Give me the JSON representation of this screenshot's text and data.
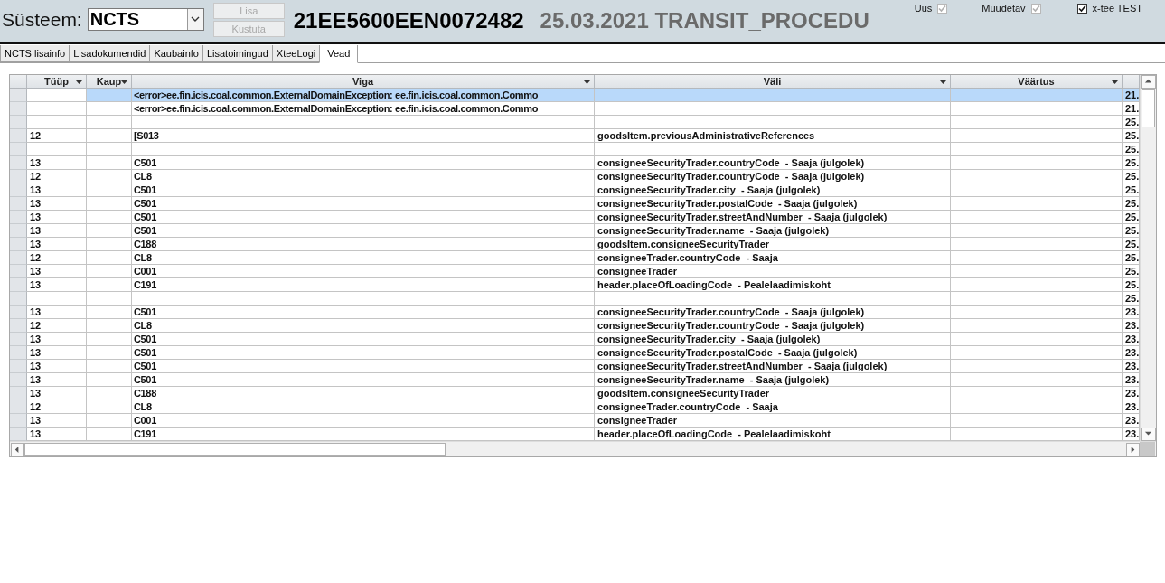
{
  "header": {
    "system_label": "Süsteem:",
    "system_value": "NCTS",
    "buttons": [
      {
        "label": "Lisa",
        "disabled": true
      },
      {
        "label": "Kustuta",
        "disabled": true
      }
    ],
    "document_number": "21EE5600EEN0072482",
    "document_subtitle": "25.03.2021 TRANSIT_PROCEDU",
    "checkboxes": [
      {
        "label": "Uus",
        "checked": true,
        "disabled": true
      },
      {
        "label": "Muudetav",
        "checked": true,
        "disabled": true
      },
      {
        "label": "x-tee TEST",
        "checked": true,
        "disabled": false
      }
    ]
  },
  "tabs": [
    {
      "label": "NCTS lisainfo",
      "selected": false
    },
    {
      "label": "Lisadokumendid",
      "selected": false
    },
    {
      "label": "Kaubainfo",
      "selected": false
    },
    {
      "label": "Lisatoimingud",
      "selected": false
    },
    {
      "label": "XteeLogi",
      "selected": false
    },
    {
      "label": "Vead",
      "selected": true
    }
  ],
  "table": {
    "columns": [
      "Tüüp",
      "Kaup",
      "Viga",
      "Väli",
      "Väärtus"
    ],
    "rows": [
      {
        "selected": true,
        "viga": "<error>ee.fin.icis.coal.common.ExternalDomainException: ee.fin.icis.coal.common.Commo",
        "column_6": "21."
      },
      {
        "selected": false,
        "viga": "<error>ee.fin.icis.coal.common.ExternalDomainException: ee.fin.icis.coal.common.Commo",
        "column_6": "21."
      },
      {
        "selected": false,
        "column_6": "25."
      },
      {
        "selected": false,
        "tyyp": "12",
        "viga": "[S013",
        "vali": "goodsItem.previousAdministrativeReferences",
        "column_6": "25."
      },
      {
        "selected": false,
        "column_6": "25."
      },
      {
        "selected": false,
        "tyyp": "13",
        "viga": "C501",
        "vali": "consigneeSecurityTrader.countryCode  - Saaja (julgolek)",
        "column_6": "25."
      },
      {
        "selected": false,
        "tyyp": "12",
        "viga": "CL8",
        "vali": "consigneeSecurityTrader.countryCode  - Saaja (julgolek)",
        "column_6": "25."
      },
      {
        "selected": false,
        "tyyp": "13",
        "viga": "C501",
        "vali": "consigneeSecurityTrader.city  - Saaja (julgolek)",
        "column_6": "25."
      },
      {
        "selected": false,
        "tyyp": "13",
        "viga": "C501",
        "vali": "consigneeSecurityTrader.postalCode  - Saaja (julgolek)",
        "column_6": "25."
      },
      {
        "selected": false,
        "tyyp": "13",
        "viga": "C501",
        "vali": "consigneeSecurityTrader.streetAndNumber  - Saaja (julgolek)",
        "column_6": "25."
      },
      {
        "selected": false,
        "tyyp": "13",
        "viga": "C501",
        "vali": "consigneeSecurityTrader.name  - Saaja (julgolek)",
        "column_6": "25."
      },
      {
        "selected": false,
        "tyyp": "13",
        "viga": "C188",
        "vali": "goodsItem.consigneeSecurityTrader",
        "column_6": "25."
      },
      {
        "selected": false,
        "tyyp": "12",
        "viga": "CL8",
        "vali": "consigneeTrader.countryCode  - Saaja",
        "column_6": "25."
      },
      {
        "selected": false,
        "tyyp": "13",
        "viga": "C001",
        "vali": "consigneeTrader",
        "column_6": "25."
      },
      {
        "selected": false,
        "tyyp": "13",
        "viga": "C191",
        "vali": "header.placeOfLoadingCode  - Pealelaadimiskoht",
        "column_6": "25."
      },
      {
        "selected": false,
        "column_6": "25."
      },
      {
        "selected": false,
        "tyyp": "13",
        "viga": "C501",
        "vali": "consigneeSecurityTrader.countryCode  - Saaja (julgolek)",
        "column_6": "23."
      },
      {
        "selected": false,
        "tyyp": "12",
        "viga": "CL8",
        "vali": "consigneeSecurityTrader.countryCode  - Saaja (julgolek)",
        "column_6": "23."
      },
      {
        "selected": false,
        "tyyp": "13",
        "viga": "C501",
        "vali": "consigneeSecurityTrader.city  - Saaja (julgolek)",
        "column_6": "23."
      },
      {
        "selected": false,
        "tyyp": "13",
        "viga": "C501",
        "vali": "consigneeSecurityTrader.postalCode  - Saaja (julgolek)",
        "column_6": "23."
      },
      {
        "selected": false,
        "tyyp": "13",
        "viga": "C501",
        "vali": "consigneeSecurityTrader.streetAndNumber  - Saaja (julgolek)",
        "column_6": "23."
      },
      {
        "selected": false,
        "tyyp": "13",
        "viga": "C501",
        "vali": "consigneeSecurityTrader.name  - Saaja (julgolek)",
        "column_6": "23."
      },
      {
        "selected": false,
        "tyyp": "13",
        "viga": "C188",
        "vali": "goodsItem.consigneeSecurityTrader",
        "column_6": "23."
      },
      {
        "selected": false,
        "tyyp": "12",
        "viga": "CL8",
        "vali": "consigneeTrader.countryCode  - Saaja",
        "column_6": "23."
      },
      {
        "selected": false,
        "tyyp": "13",
        "viga": "C001",
        "vali": "consigneeTrader",
        "column_6": "23."
      },
      {
        "selected": false,
        "tyyp": "13",
        "viga": "C191",
        "vali": "header.placeOfLoadingCode  - Pealelaadimiskoht",
        "column_6": "23."
      }
    ]
  }
}
